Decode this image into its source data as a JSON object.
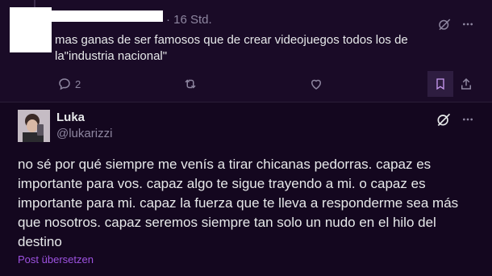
{
  "reply_post": {
    "time": "· 16 Std.",
    "text": "mas ganas de ser famosos que de crear videojuegos todos los de la\"industria nacional\"",
    "reply_count": "2"
  },
  "main_post": {
    "author_name": "Luka",
    "handle": "@lukarizzi",
    "text": "no sé por qué siempre me venís a tirar chicanas pedorras. capaz es importante para vos. capaz algo te sigue trayendo a mi. o capaz es importante para mi. capaz la fuerza que te lleva a responderme sea más que nosotros. capaz seremos siempre tan solo un nudo en el hilo del destino",
    "translate_label": "Post übersetzen"
  },
  "colors": {
    "background": "#14071f",
    "accent": "#9d52e0"
  },
  "icons": [
    "grok-icon",
    "more-icon",
    "reply-icon",
    "repost-icon",
    "like-icon",
    "bookmark-icon",
    "share-icon"
  ]
}
